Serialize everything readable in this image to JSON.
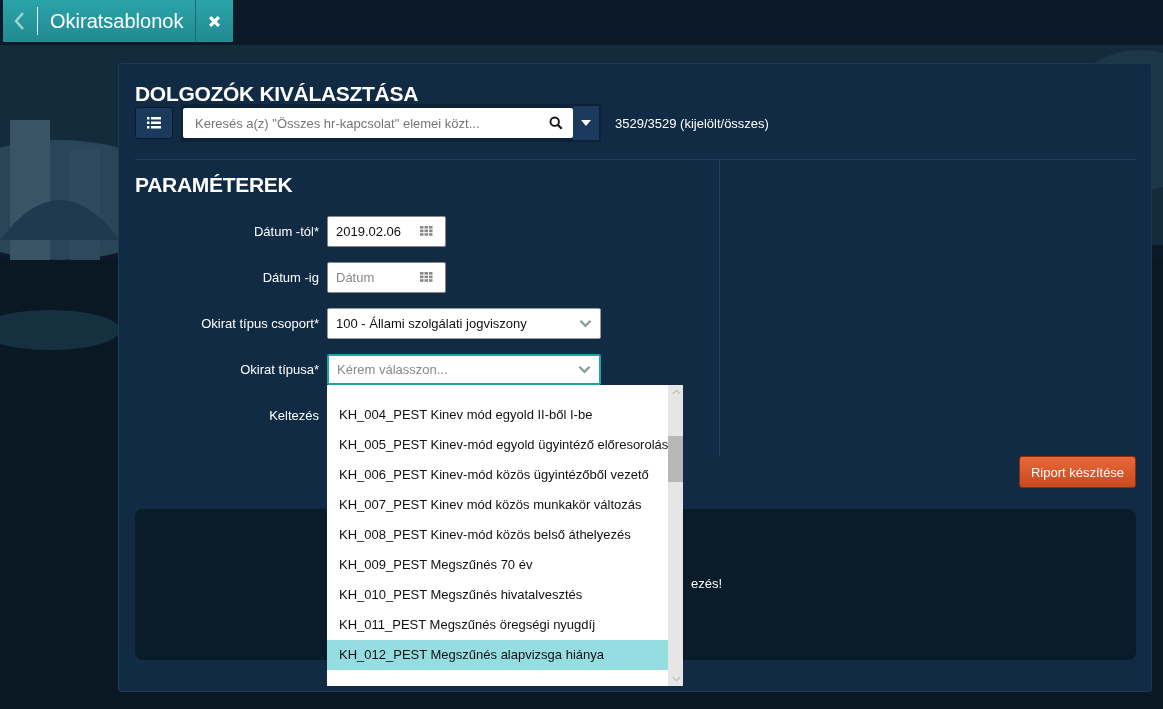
{
  "tab": {
    "title": "Okiratsablonok"
  },
  "selection": {
    "title": "DOLGOZÓK KIVÁLASZTÁSA",
    "search_placeholder": "Keresés a(z) \"Összes hr-kapcsolat\" elemei közt...",
    "count": "3529/3529 (kijelölt/összes)"
  },
  "parameters": {
    "title": "PARAMÉTEREK",
    "fields": [
      {
        "label": "Dátum -tól*",
        "kind": "date",
        "value": "2019.02.06"
      },
      {
        "label": "Dátum -ig",
        "kind": "date",
        "placeholder": "Dátum"
      },
      {
        "label": "Okirat típus csoport*",
        "kind": "select",
        "value": "100 - Állami szolgálati jogviszony"
      },
      {
        "label": "Okirat típusa*",
        "kind": "select",
        "placeholder": "Kérem válasszon...",
        "expanded": true,
        "options": [
          {
            "label": "KH_004_PEST Kinev mód egyold II-ből I-be",
            "selected": false
          },
          {
            "label": "KH_005_PEST Kinev-mód egyold ügyintéző előresorolás",
            "selected": false
          },
          {
            "label": "KH_006_PEST Kinev-mód közös ügyintézőből vezető",
            "selected": false
          },
          {
            "label": "KH_007_PEST Kinev mód közös munkakör változás",
            "selected": false
          },
          {
            "label": "KH_008_PEST Kinev-mód közös belső áthelyezés",
            "selected": false
          },
          {
            "label": "KH_009_PEST Megszűnés 70 év",
            "selected": false
          },
          {
            "label": "KH_010_PEST Megszűnés hivatalvesztés",
            "selected": false
          },
          {
            "label": "KH_011_PEST Megszűnés öregségi nyugdíj",
            "selected": false
          },
          {
            "label": "KH_012_PEST Megszűnés alapvizsga hiánya",
            "selected": true
          }
        ]
      },
      {
        "label": "Keltezés",
        "kind": "covered"
      }
    ]
  },
  "report_button": "Riport készítése",
  "result": {
    "message": "ezés!"
  }
}
